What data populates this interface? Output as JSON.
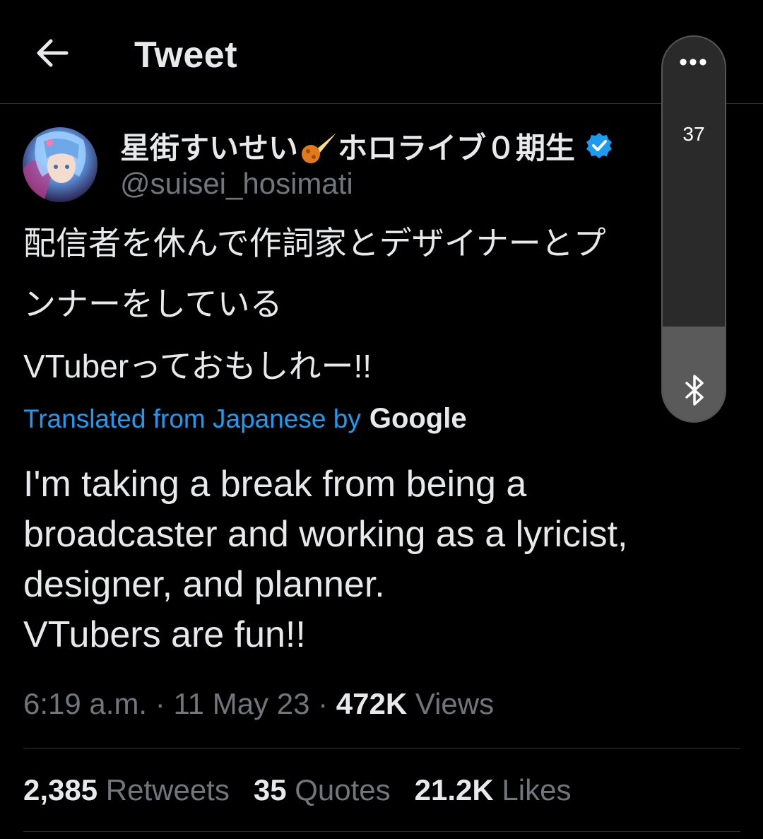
{
  "header": {
    "title": "Tweet"
  },
  "author": {
    "name_prefix": "星街すいせい",
    "name_suffix": "ホロライブ０期生",
    "handle": "@suisei_hosimati"
  },
  "tweet": {
    "jp_lines": [
      "配信者を休んで作詞家とデザイナーとプ",
      "ンナーをしている",
      "VTuberっておもしれー!!"
    ],
    "translated_label": "Translated from Japanese by",
    "translator": "Google",
    "en_lines": [
      "I'm taking a break from being a",
      "broadcaster and working as a lyricist,",
      "designer, and planner.",
      "VTubers are fun!!"
    ]
  },
  "meta": {
    "time": "6:19 a.m.",
    "sep1": " · ",
    "date": "11 May 23",
    "sep2": " · ",
    "views_count": "472K",
    "views_label": " Views"
  },
  "stats": {
    "retweets_count": "2,385",
    "retweets_label": " Retweets",
    "quotes_count": "35",
    "quotes_label": " Quotes",
    "likes_count": "21.2K",
    "likes_label": " Likes"
  },
  "volume": {
    "level_text": "37",
    "level_fraction": 0.37,
    "icon": "bluetooth-icon"
  },
  "colors": {
    "background": "#000000",
    "link": "#1d9bf0",
    "verified": "#1d9bf0",
    "muted": "#71767b"
  }
}
